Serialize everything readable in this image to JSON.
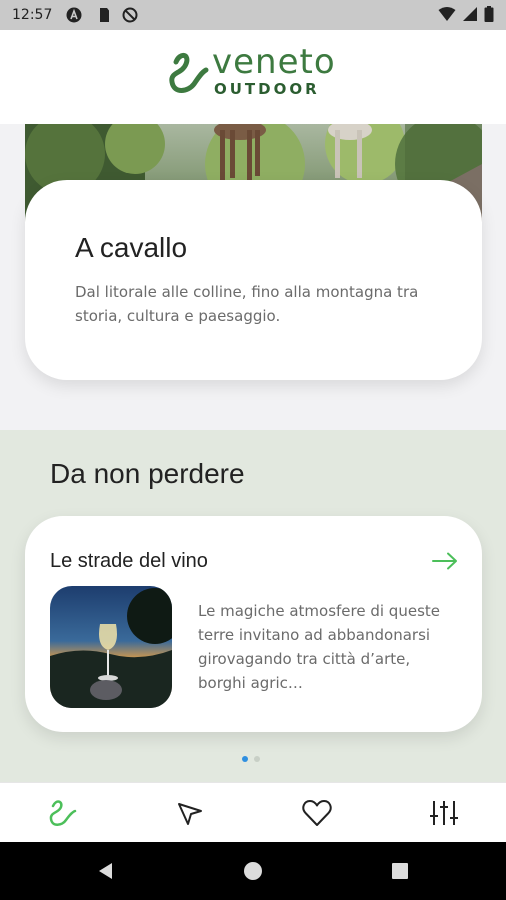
{
  "status_bar": {
    "time": "12:57",
    "left_icons": [
      "a-circle-icon",
      "sd-card-icon",
      "no-disturb-icon"
    ],
    "right_icons": [
      "wifi-icon",
      "signal-icon",
      "battery-icon"
    ]
  },
  "header": {
    "logo_main": "veneto",
    "logo_sub": "OUTDOOR",
    "brand_color": "#3d7a40"
  },
  "hero_card": {
    "title": "A cavallo",
    "description": "Dal litorale alle colline, fino alla montagna tra storia, cultura e paesaggio."
  },
  "highlights": {
    "heading": "Da non perdere",
    "card": {
      "title": "Le strade del vino",
      "description": "Le magiche atmosfere di queste terre invitano ad abbandonarsi girovagando tra città d’arte, borghi agric…",
      "arrow_icon": "arrow-right-icon",
      "accent_color": "#4cbf5a"
    },
    "pagination": {
      "total": 2,
      "active": 1
    }
  },
  "bottom_nav": {
    "items": [
      {
        "icon": "veneto-logo-icon",
        "active": true
      },
      {
        "icon": "navigation-icon",
        "active": false
      },
      {
        "icon": "heart-icon",
        "active": false
      },
      {
        "icon": "filters-icon",
        "active": false
      }
    ]
  },
  "system_nav": [
    "back-icon",
    "home-icon",
    "recents-icon"
  ]
}
